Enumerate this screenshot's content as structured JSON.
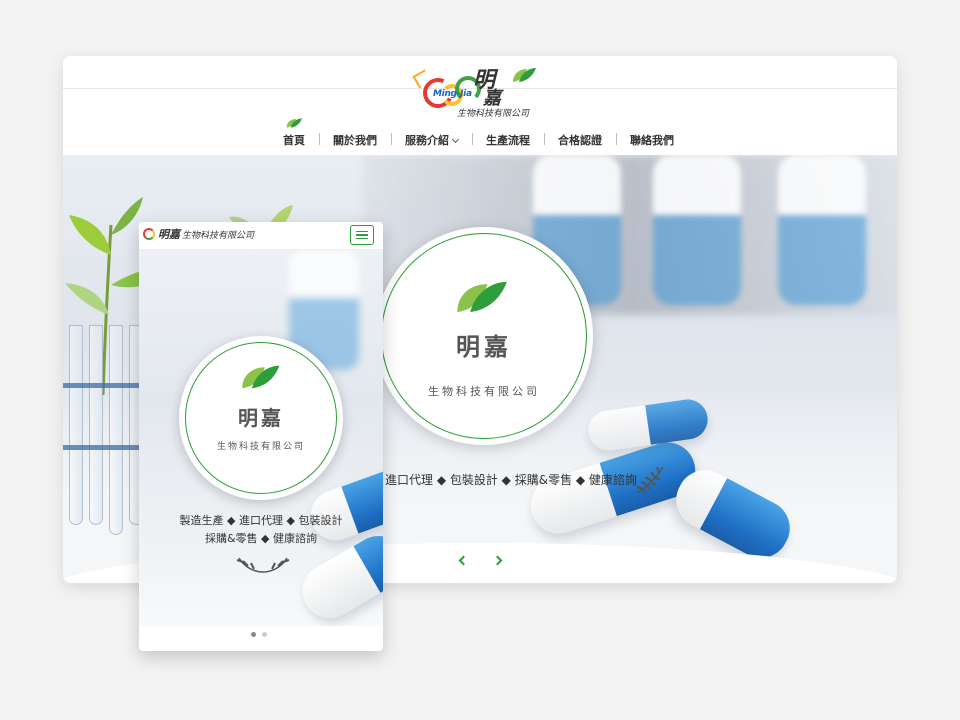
{
  "desktop": {
    "logo": {
      "name_line1": "明",
      "name_line2": "嘉",
      "english": "Ming-Jia",
      "subtitle": "生物科技有限公司"
    },
    "nav": [
      {
        "label": "首頁",
        "active": true
      },
      {
        "label": "關於我們"
      },
      {
        "label": "服務介紹",
        "dropdown": true
      },
      {
        "label": "生產流程"
      },
      {
        "label": "合格認證"
      },
      {
        "label": "聯絡我們"
      }
    ],
    "hero": {
      "badge_title": "明嘉",
      "badge_subtitle": "生物科技有限公司",
      "tagline": "進口代理 ◆ 包裝設計 ◆ 採購&零售 ◆ 健康諮詢"
    }
  },
  "mobile": {
    "logo_text": "生物科技有限公司",
    "logo_mark": "明嘉",
    "hero": {
      "badge_title": "明嘉",
      "badge_subtitle": "生物科技有限公司",
      "tagline_line1": "製造生產 ◆ 進口代理 ◆ 包裝設計",
      "tagline_line2": "採購&零售 ◆ 健康諮詢"
    },
    "slider": {
      "total": 2,
      "active": 1
    }
  },
  "colors": {
    "accent_green": "#2e9d3a",
    "capsule_blue": "#1e6fc4",
    "background": "#f3f3f4"
  },
  "icons": [
    "leaf-icon",
    "chevron-down-icon",
    "chevron-left-icon",
    "chevron-right-icon",
    "hamburger-icon",
    "laurel-icon"
  ]
}
